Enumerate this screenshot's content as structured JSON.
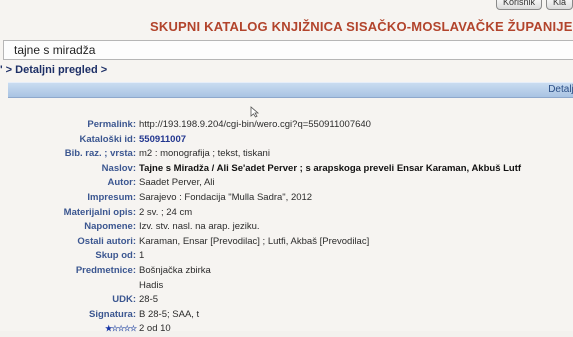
{
  "header": {
    "buttons": [
      "Korisnik",
      "Kla"
    ],
    "title": "SKUPNI KATALOG KNJIŽNICA SISAČKO-MOSLAVAČKE ŽUPANIJE"
  },
  "search": {
    "value": "tajne s miradža"
  },
  "breadcrumb": "' > Detaljni pregled >",
  "detail_bar": {
    "label": "Detalji"
  },
  "record": {
    "permalink": {
      "label": "Permalink:",
      "value": "http://193.198.9.204/cgi-bin/wero.cgi?q=550911007640"
    },
    "catalog_id": {
      "label": "Kataloški id:",
      "value": "550911007"
    },
    "bib_type": {
      "label": "Bib. raz. ; vrsta:",
      "value": "m2 : monografija ; tekst, tiskani"
    },
    "title": {
      "label": "Naslov:",
      "value": "Tajne s Miradža / Ali Se'adet Perver ; s arapskoga preveli Ensar Karaman, Akbuš Lutf"
    },
    "author": {
      "label": "Autor:",
      "value": "Saadet Perver, Ali"
    },
    "imprint": {
      "label": "Impresum:",
      "value": "Sarajevo : Fondacija \"Mulla Sadra\", 2012"
    },
    "physical": {
      "label": "Materijalni opis:",
      "value": "2 sv. ; 24 cm"
    },
    "notes": {
      "label": "Napomene:",
      "value": "Izv. stv. nasl. na arap. jeziku."
    },
    "other_authors": {
      "label": "Ostali autori:",
      "value": "Karaman, Ensar [Prevodilac] ; Lutfi, Akbaš [Prevodilac]"
    },
    "set_of": {
      "label": "Skup od:",
      "value": "1"
    },
    "subjects": {
      "label": "Predmetnice:",
      "values": [
        "Bošnjačka zbirka",
        "Hadis"
      ]
    },
    "udk": {
      "label": "UDK:",
      "value": "28-5"
    },
    "signature": {
      "label": "Signatura:",
      "value": "B 28-5; SAA, t"
    },
    "rating": {
      "stars_filled": 1,
      "stars_total": 5,
      "text": "2 od 10"
    }
  }
}
